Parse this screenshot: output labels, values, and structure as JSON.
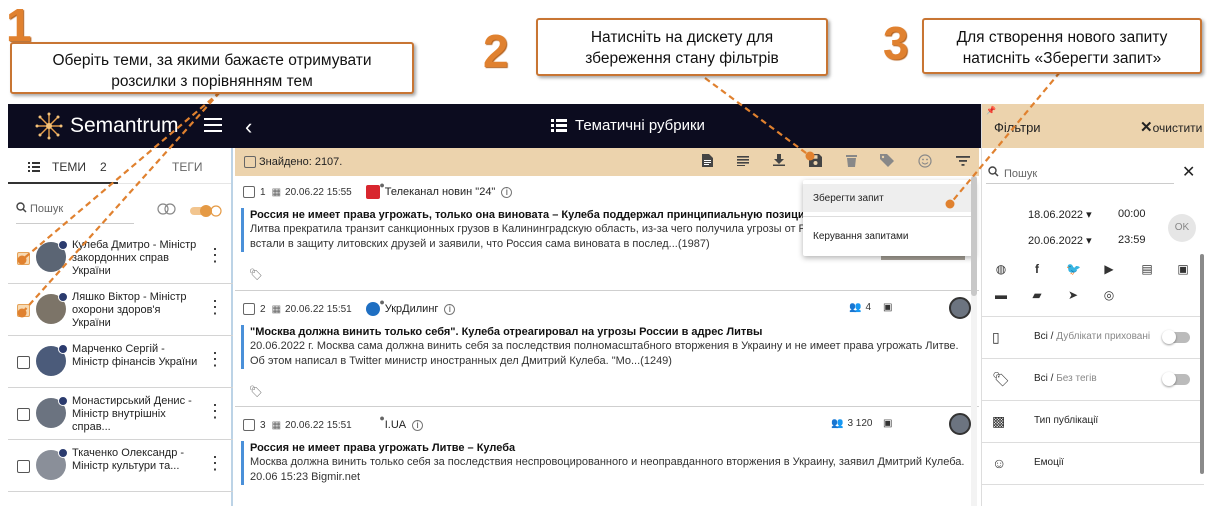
{
  "annotations": {
    "step1": {
      "num": "1",
      "text": "Оберіть теми, за якими бажаєте отримувати розсилки з порівнянням тем"
    },
    "step2": {
      "num": "2",
      "text": "Натисніть на дискету для збереження стану фільтрів"
    },
    "step3": {
      "num": "3",
      "text": "Для створення нового запиту натисніть «Зберегти запит»"
    },
    "accent_color": "#e0812f"
  },
  "app": {
    "brand": "Semantrum",
    "page_title": "Тематичні рубрики",
    "topbar_color": "#0c0c1f",
    "filter_header_color": "#ecd3ad"
  },
  "left": {
    "tab_themes": "ТЕМИ",
    "tab_themes_count": "2",
    "tab_tags": "ТЕГИ",
    "search_placeholder": "Пошук",
    "persons": [
      {
        "name": "Кулеба Дмитро - Міністр закордонних справ України",
        "checked": true
      },
      {
        "name": "Ляшко Віктор - Міністр охорони здоров'я України",
        "checked": true
      },
      {
        "name": "Марченко Сергій - Міністр фінансів України",
        "checked": false
      },
      {
        "name": "Монастирський Денис - Міністр внутрішніх справ...",
        "checked": false
      },
      {
        "name": "Ткаченко Олександр - Міністр культури та...",
        "checked": false
      }
    ]
  },
  "center": {
    "found": "Знайдено: 2107.",
    "menu": {
      "save_query": "Зберегти запит",
      "manage_queries": "Керування запитами"
    },
    "articles": [
      {
        "num": "1",
        "date": "20.06.22 15:55",
        "source": "Телеканал новин \"24\"",
        "title": "Россия не имеет права угрожать, только она виновата – Кулеба поддержал принципиальную позицию Литвы",
        "snippet": "Литва прекратила транзит санкционных грузов в Калининградскую область, из-за чего получила угрозы от Р Украины встали в защиту литовских друзей и заявили, что Россия сама виновата в послед...(1987)",
        "reach": "",
        "source_color": "#d8262e"
      },
      {
        "num": "2",
        "date": "20.06.22 15:51",
        "source": "УкрДилинг",
        "title": "\"Москва должна винить только себя\". Кулеба отреагировал на угрозы России в адрес Литвы",
        "snippet": "20.06.2022 г. Москва сама должна винить себя за последствия полномасштабного вторжения в Украину и не имеет права угрожать Литве. Об этом написал в Twitter министр иностранных дел Дмитрий Кулеба. \"Мо...(1249)",
        "reach": "4",
        "source_color": "#1f6fc2"
      },
      {
        "num": "3",
        "date": "20.06.22 15:51",
        "source": "I.UA",
        "title": "Россия не имеет права угрожать Литве – Кулеба",
        "snippet": "Москва должна винить только себя за последствия неспровоцированного и неоправданного вторжения в Украину, заявил Дмитрий Кулеба. 20.06 15:23 Bigmir.net",
        "reach": "3 120",
        "source_color": "#ffffff"
      }
    ]
  },
  "right": {
    "title": "Фільтри",
    "clear": "очистити",
    "search_placeholder": "Пошук",
    "date_from": "18.06.2022",
    "time_from": "00:00",
    "date_to": "20.06.2022",
    "time_to": "23:59",
    "ok": "OK",
    "rows": [
      {
        "main": "Всі /",
        "sub": "Дублікати приховані"
      },
      {
        "main": "Всі /",
        "sub": "Без тегів"
      },
      {
        "main": "Тип публікації",
        "sub": ""
      },
      {
        "main": "Емоції",
        "sub": ""
      }
    ]
  }
}
